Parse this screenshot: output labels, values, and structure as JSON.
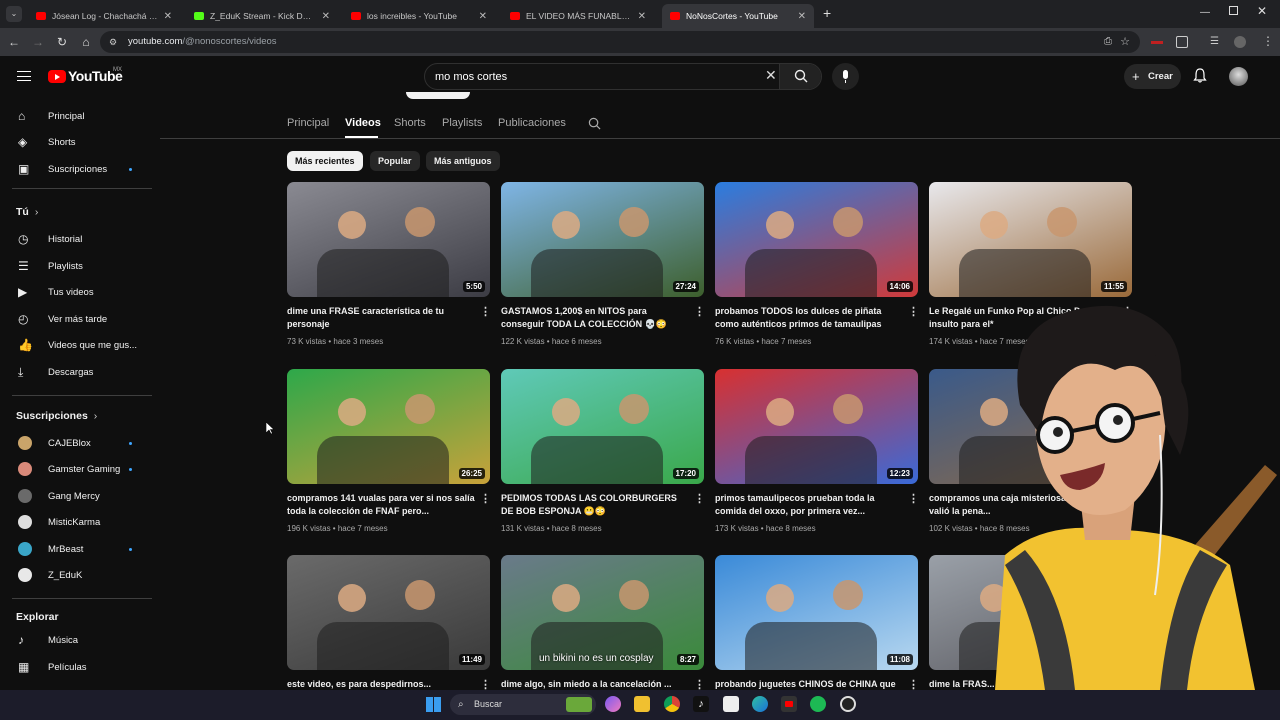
{
  "browser": {
    "tabs": [
      {
        "title": "Jósean Log - Chachachá (Lyric V",
        "color": "#ff0000"
      },
      {
        "title": "Z_EduK Stream - Kick Dashboar",
        "color": "#53fc18"
      },
      {
        "title": "los increibles - YouTube",
        "color": "#ff0000"
      },
      {
        "title": "EL VIDEO MÁS FUNABLE DE MI",
        "color": "#ff0000"
      },
      {
        "title": "NoNosCortes - YouTube",
        "color": "#ff0000"
      }
    ],
    "url_host": "youtube.com",
    "url_path": "/@nonoscortes/videos"
  },
  "header": {
    "logo": "YouTube",
    "region": "MX",
    "search_value": "mo mos cortes",
    "create_label": "Crear"
  },
  "sidebar": {
    "main": [
      {
        "label": "Principal",
        "icon": "home-icon"
      },
      {
        "label": "Shorts",
        "icon": "shorts-icon"
      },
      {
        "label": "Suscripciones",
        "icon": "subscriptions-icon"
      }
    ],
    "you_heading": "Tú",
    "you": [
      {
        "label": "Historial",
        "icon": "history-icon"
      },
      {
        "label": "Playlists",
        "icon": "playlists-icon"
      },
      {
        "label": "Tus videos",
        "icon": "your-videos-icon"
      },
      {
        "label": "Ver más tarde",
        "icon": "watch-later-icon"
      },
      {
        "label": "Videos que me gus...",
        "icon": "like-icon"
      },
      {
        "label": "Descargas",
        "icon": "download-icon"
      }
    ],
    "subs_heading": "Suscripciones",
    "subs": [
      {
        "label": "CAJEBlox",
        "color": "#c9a46a",
        "dot": true
      },
      {
        "label": "Gamster Gaming",
        "color": "#d98a7a",
        "dot": true
      },
      {
        "label": "Gang Mercy",
        "color": "#6a6a6a",
        "dot": false
      },
      {
        "label": "MisticKarma",
        "color": "#dddddd",
        "dot": false
      },
      {
        "label": "MrBeast",
        "color": "#3aa6c8",
        "dot": true
      },
      {
        "label": "Z_EduK",
        "color": "#e8e8e8",
        "dot": false
      }
    ],
    "explore_heading": "Explorar",
    "explore": [
      {
        "label": "Música",
        "icon": "music-icon"
      },
      {
        "label": "Películas",
        "icon": "movies-icon"
      }
    ]
  },
  "channel_tabs": [
    "Principal",
    "Videos",
    "Shorts",
    "Playlists",
    "Publicaciones"
  ],
  "chips": [
    "Más recientes",
    "Popular",
    "Más antiguos"
  ],
  "videos": [
    {
      "title": "dime una FRASE característica de tu personaje",
      "views": "73 K vistas",
      "age": "hace 3 meses",
      "duration": "5:50",
      "c1": "#8a8a92",
      "c2": "#3c3c44"
    },
    {
      "title": "GASTAMOS 1,200$ en NITOS para conseguir TODA LA COLECCIÓN 💀😳",
      "views": "122 K vistas",
      "age": "hace 6 meses",
      "duration": "27:24",
      "c1": "#7fb5e6",
      "c2": "#3d5f2c"
    },
    {
      "title": "probamos TODOS los dulces de piñata como auténticos primos de tamaulipas",
      "views": "76 K vistas",
      "age": "hace 7 meses",
      "duration": "14:06",
      "c1": "#2a7de0",
      "c2": "#d03a3a"
    },
    {
      "title": "Le Regalé un Funko Pop al Chico D... es un insulto para el*",
      "views": "174 K vistas",
      "age": "hace 7 meses",
      "duration": "11:55",
      "c1": "#e8e8ec",
      "c2": "#9a6a3a"
    },
    {
      "title": "compramos 141 vualas para ver si nos salía toda la colección de FNAF pero...",
      "views": "196 K vistas",
      "age": "hace 7 meses",
      "duration": "26:25",
      "c1": "#2da84a",
      "c2": "#c8a23a"
    },
    {
      "title": "PEDIMOS TODAS LAS COLORBURGERS DE BOB ESPONJA 😬😳",
      "views": "131 K vistas",
      "age": "hace 8 meses",
      "duration": "17:20",
      "c1": "#5fc9b8",
      "c2": "#3aa84a"
    },
    {
      "title": "primos tamaulipecos prueban toda la comida del oxxo, por primera vez...",
      "views": "173 K vistas",
      "age": "hace 8 meses",
      "duration": "12:23",
      "c1": "#d83030",
      "c2": "#3a6ad8"
    },
    {
      "title": "compramos una caja misteriosa... no se valió la pena...",
      "views": "102 K vistas",
      "age": "hace 8 meses",
      "duration": "",
      "c1": "#3a5a8a",
      "c2": "#8a6a4a"
    },
    {
      "title": "este video, es para despedirnos...",
      "views": "",
      "age": "",
      "duration": "11:49",
      "c1": "#6a6a6a",
      "c2": "#3a3a3a"
    },
    {
      "title": "dime algo, sin miedo a la cancelación ...",
      "views": "",
      "age": "",
      "duration": "8:27",
      "c1": "#6a7a8a",
      "c2": "#3a8a3a",
      "caption": "un bikini no es un cosplay"
    },
    {
      "title": "probando juguetes CHINOS de CHINA que",
      "views": "",
      "age": "",
      "duration": "11:08",
      "c1": "#3a8ad8",
      "c2": "#b8d8f0"
    },
    {
      "title": "dime la FRAS...",
      "views": "",
      "age": "",
      "duration": "",
      "c1": "#9aa0a8",
      "c2": "#5a5a60"
    }
  ],
  "taskbar": {
    "search_label": "Buscar"
  }
}
